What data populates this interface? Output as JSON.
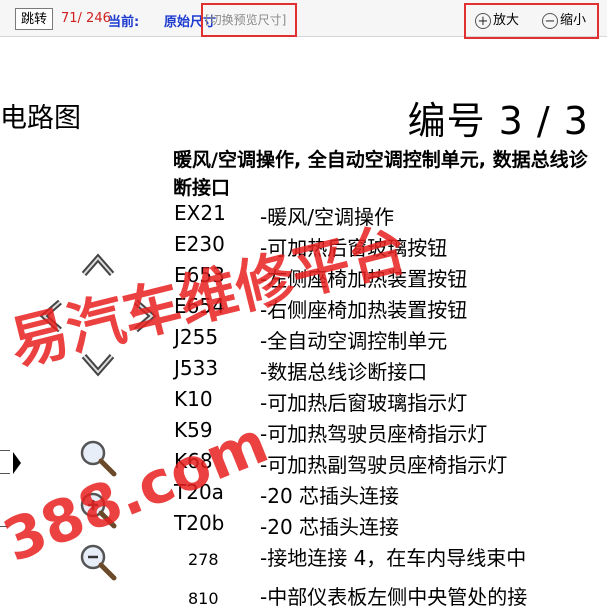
{
  "toolbar": {
    "jump_label": "跳转",
    "page_indicator": "71/ 246",
    "current_label": "当前:",
    "current_mode": "原始尺寸",
    "switch_link": "[切换预览尺寸]",
    "zoom_in_label": "放大",
    "zoom_out_label": "缩小",
    "highlight_color": "#e03030"
  },
  "document": {
    "left_title_fragment": "电路图",
    "number_text": "编号 3 / 3",
    "heading": "暖风/空调操作, 全自动空调控制单元, 数据总线诊断接口",
    "components": [
      {
        "code": "EX21",
        "desc": "-暖风/空调操作"
      },
      {
        "code": "E230",
        "desc": "-可加热后窗玻璃按钮"
      },
      {
        "code": "E653",
        "desc": "-左侧座椅加热装置按钮"
      },
      {
        "code": "E654",
        "desc": "-右侧座椅加热装置按钮"
      },
      {
        "code": "J255",
        "desc": "-全自动空调控制单元"
      },
      {
        "code": "J533",
        "desc": "-数据总线诊断接口"
      },
      {
        "code": "K10",
        "desc": "-可加热后窗玻璃指示灯"
      },
      {
        "code": "K59",
        "desc": "-可加热驾驶员座椅指示灯"
      },
      {
        "code": "K68",
        "desc": "-可加热副驾驶员座椅指示灯"
      },
      {
        "code": "T20a",
        "desc": "-20 芯插头连接"
      },
      {
        "code": "T20b",
        "desc": "-20 芯插头连接"
      },
      {
        "code": "278",
        "desc": "-接地连接 4，在车内导线束中"
      },
      {
        "code": "810",
        "desc": "-中部仪表板左侧中央管处的接"
      }
    ]
  },
  "watermark": {
    "line1": "易汽车维修平台",
    "line2": "388.com",
    "color": "#e82020"
  },
  "icons": [
    "pan-up-icon",
    "pan-left-icon",
    "pan-right-icon",
    "pan-down-icon",
    "magnifier-icon",
    "zoom-in-magnifier-icon",
    "zoom-out-magnifier-icon"
  ]
}
